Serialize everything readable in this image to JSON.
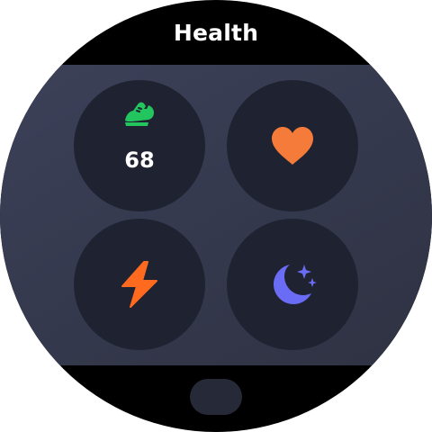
{
  "header": {
    "title": "Health"
  },
  "tiles": [
    {
      "name": "steps",
      "icon": "shoe-icon",
      "value": "68",
      "color": "#22c55e"
    },
    {
      "name": "heart-rate",
      "icon": "heart-icon",
      "color": "#f47b3a"
    },
    {
      "name": "energy",
      "icon": "lightning-icon",
      "color": "#ff6a1f"
    },
    {
      "name": "sleep",
      "icon": "moon-stars-icon",
      "color": "#6b6cf6"
    }
  ],
  "colors": {
    "background": "#000000",
    "panel": "#3a3e54",
    "tile": "#1f2230"
  }
}
